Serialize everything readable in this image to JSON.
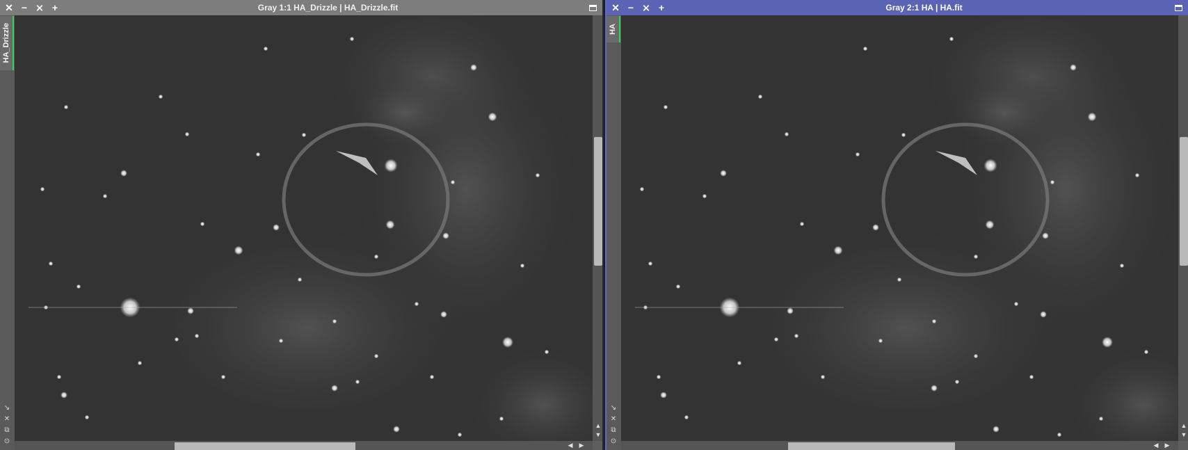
{
  "left_window": {
    "title": "Gray 1:1 HA_Drizzle | HA_Drizzle.fit",
    "side_tab": "HA_Drizzle",
    "active": false
  },
  "right_window": {
    "title": "Gray 2:1 HA | HA.fit",
    "side_tab": "HA",
    "active": true
  },
  "icons": {
    "close": "close-icon",
    "minimize": "minimize-icon",
    "shade": "shade-icon",
    "zoom": "zoom-in-icon",
    "maximize": "maximize-icon"
  },
  "colors": {
    "active_title": "#5b63b5",
    "inactive_title": "#7d7d7d",
    "tab_accent": "#2fd54f",
    "sky": "#2e2e2e"
  }
}
